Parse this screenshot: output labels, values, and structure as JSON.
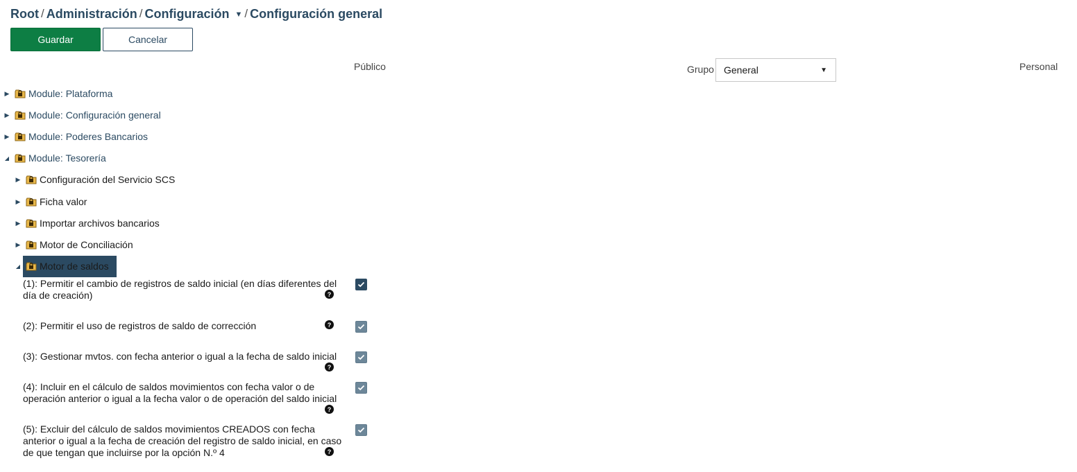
{
  "breadcrumb": {
    "items": [
      "Root",
      "Administración",
      "Configuración",
      "Configuración general"
    ],
    "separator": "/"
  },
  "toolbar": {
    "save_label": "Guardar",
    "cancel_label": "Cancelar"
  },
  "columns": {
    "public_label": "Público",
    "group_label": "Grupo",
    "personal_label": "Personal"
  },
  "group_select": {
    "value": "General"
  },
  "tree": {
    "modules": [
      {
        "label": "Module: Plataforma",
        "expanded": false
      },
      {
        "label": "Module: Configuración general",
        "expanded": false
      },
      {
        "label": "Module: Poderes Bancarios",
        "expanded": false
      },
      {
        "label": "Module: Tesorería",
        "expanded": true
      }
    ],
    "children": [
      {
        "label": "Configuración del Servicio SCS",
        "expanded": false
      },
      {
        "label": "Ficha valor",
        "expanded": false
      },
      {
        "label": "Importar archivos bancarios",
        "expanded": false
      },
      {
        "label": "Motor de Conciliación",
        "expanded": false
      },
      {
        "label": "Motor de saldos",
        "expanded": true,
        "selected": true
      }
    ]
  },
  "options": [
    {
      "line1": "(1): Permitir el cambio de registros de saldo inicial (en días diferentes del",
      "line2": "día de creación)",
      "line3": "",
      "checked": true
    },
    {
      "line1": "(2): Permitir el uso de registros de saldo de corrección",
      "line2": "",
      "line3": "",
      "checked": true
    },
    {
      "line1": "(3): Gestionar mvtos. con fecha anterior o igual a la fecha de saldo inicial",
      "line2": "",
      "line3": "",
      "checked": true
    },
    {
      "line1": "(4): Incluir en el cálculo de saldos movimientos con fecha valor o de",
      "line2": "operación anterior o igual a la fecha valor o de operación del saldo inicial",
      "line3": "",
      "checked": true
    },
    {
      "line1": "(5): Excluir del cálculo de saldos movimientos CREADOS con fecha",
      "line2": "anterior o igual a la fecha de creación del registro de saldo inicial, en caso",
      "line3": "de que tengan que incluirse por la opción N.º 4",
      "checked": true
    }
  ],
  "icons": {
    "folder": "locked-folder-icon",
    "help": "help-icon",
    "collapsed": "caret-right-icon",
    "expanded": "caret-down-icon"
  },
  "colors": {
    "primary": "#0d7e44",
    "accent": "#2b4a62",
    "selected_bg": "#2b4a62",
    "checkbox_disabled": "#6d8799"
  }
}
